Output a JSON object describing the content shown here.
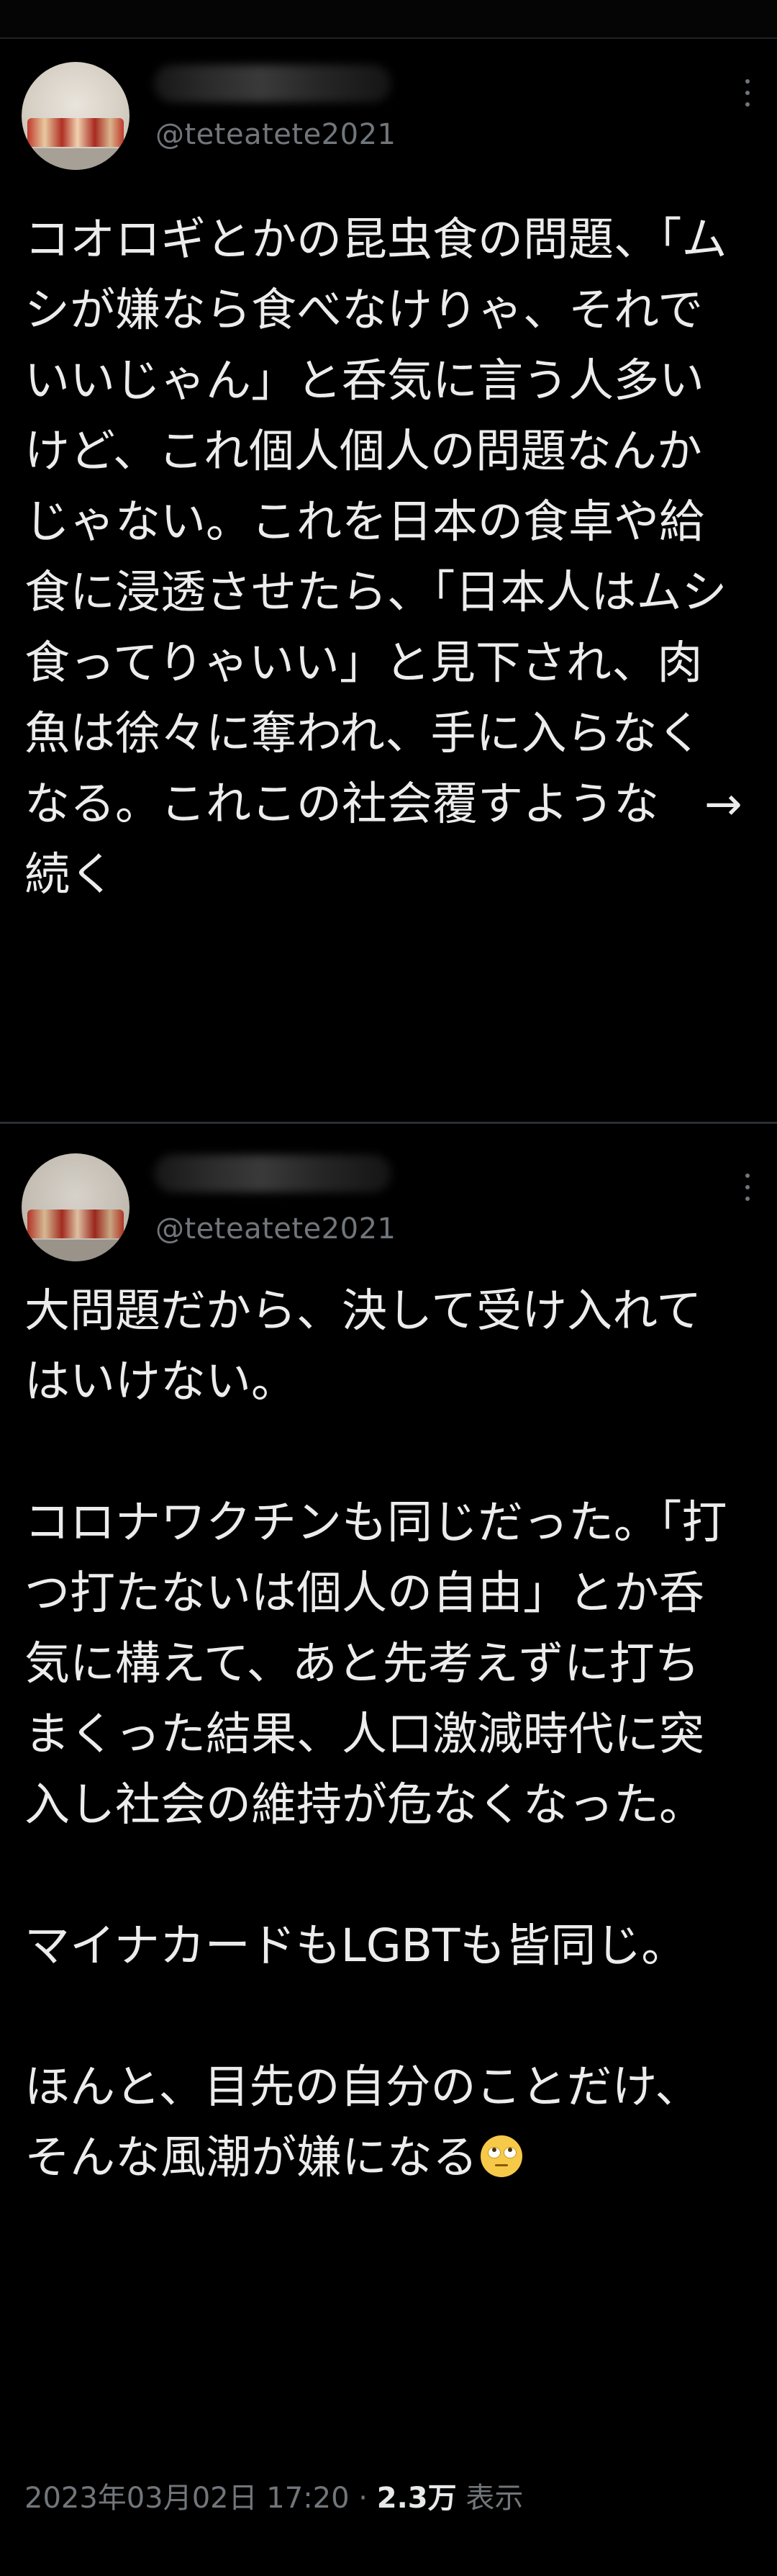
{
  "theme": {
    "background": "#000000",
    "text_primary": "#e7e9ea",
    "text_secondary": "#71767b",
    "divider": "#2b2f33"
  },
  "tweets": [
    {
      "handle": "@teteatete2021",
      "display_name_redacted": true,
      "body": "コオロギとかの昆虫食の問題、「ムシが嫌なら食べなけりゃ、それでいいじゃん」と呑気に言う人多いけど、これ個人個人の問題なんかじゃない。これを日本の食卓や給食に浸透させたら、「日本人はムシ食ってりゃいい」と見下され、肉魚は徐々に奪われ、手に入らなくなる。これこの社会覆すような　→続く"
    },
    {
      "handle": "@teteatete2021",
      "display_name_redacted": true,
      "body": "大問題だから、決して受け入れてはいけない。\n\nコロナワクチンも同じだった。「打つ打たないは個人の自由」とか呑気に構えて、あと先考えずに打ちまくった結果、人口激減時代に突入し社会の維持が危なくなった。\n\nマイナカードもLGBTも皆同じ。\n\nほんと、目先の自分のことだけ、そんな風潮が嫌になる",
      "emoji": "face-with-rolling-eyes",
      "timestamp": "2023年03月02日 17:20",
      "separator": " · ",
      "views_count": "2.3万",
      "views_label": " 表示"
    }
  ],
  "icons": {
    "more": "more-horizontal-icon"
  }
}
